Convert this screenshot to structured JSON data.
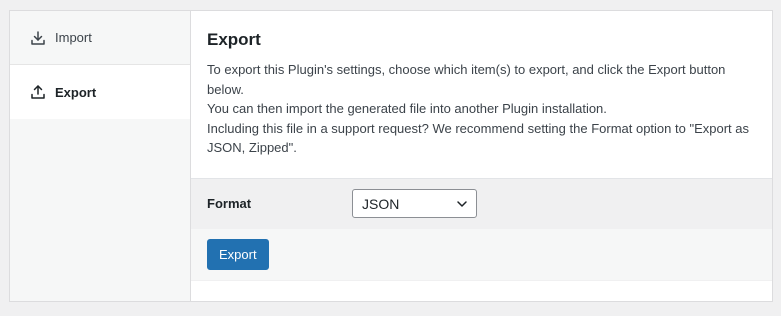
{
  "sidebar": {
    "items": [
      {
        "label": "Import",
        "icon": "download-icon",
        "active": false
      },
      {
        "label": "Export",
        "icon": "upload-icon",
        "active": true
      }
    ]
  },
  "main": {
    "title": "Export",
    "description": [
      "To export this Plugin's settings, choose which item(s) to export, and click the Export button below.",
      "You can then import the generated file into another Plugin installation.",
      "Including this file in a support request? We recommend setting the Format option to \"Export as JSON, Zipped\"."
    ],
    "format": {
      "label": "Format",
      "selected": "JSON"
    },
    "export_button_label": "Export"
  },
  "colors": {
    "primary": "#2271b1",
    "background": "#f0f0f1",
    "panel": "#ffffff",
    "text": "#1d2327"
  }
}
